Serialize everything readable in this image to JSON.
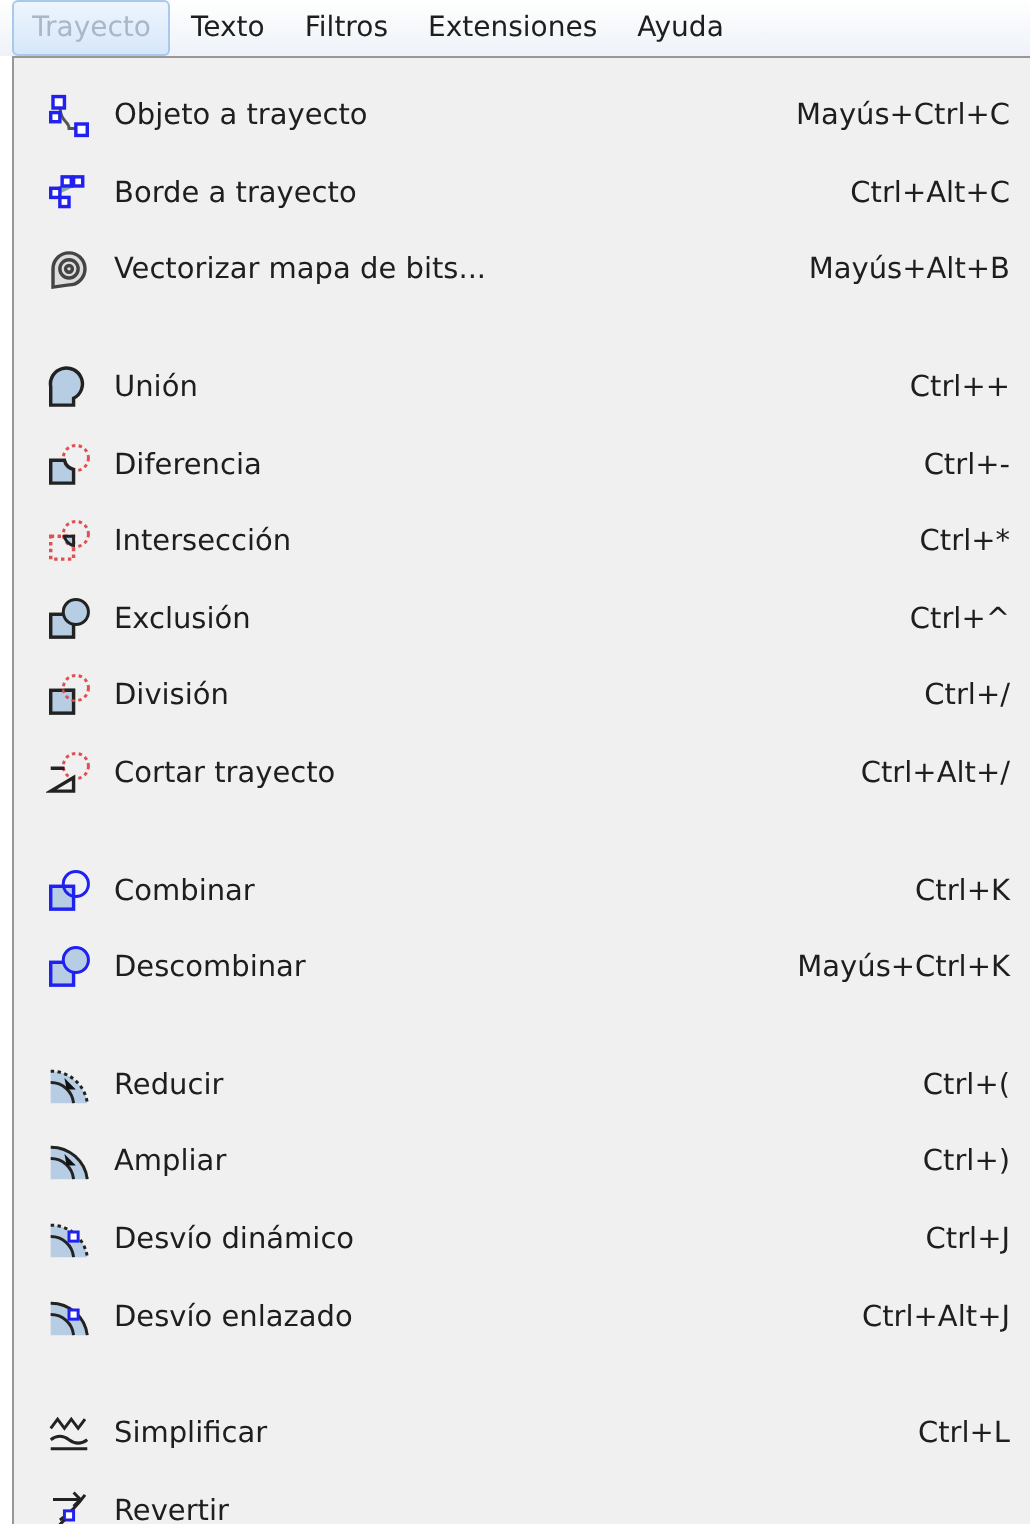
{
  "menubar": [
    {
      "label": "Trayecto",
      "selected": true
    },
    {
      "label": "Texto",
      "selected": false
    },
    {
      "label": "Filtros",
      "selected": false
    },
    {
      "label": "Extensiones",
      "selected": false
    },
    {
      "label": "Ayuda",
      "selected": false
    }
  ],
  "menu": {
    "groups": [
      [
        {
          "kind": "object-to-path",
          "label": "Objeto a trayecto",
          "shortcut": "Mayús+Ctrl+C"
        },
        {
          "kind": "stroke-to-path",
          "label": "Borde a trayecto",
          "shortcut": "Ctrl+Alt+C"
        },
        {
          "kind": "trace",
          "label": "Vectorizar mapa de bits...",
          "shortcut": "Mayús+Alt+B"
        }
      ],
      [
        {
          "kind": "union",
          "label": "Unión",
          "shortcut": "Ctrl++"
        },
        {
          "kind": "difference",
          "label": "Diferencia",
          "shortcut": "Ctrl+-"
        },
        {
          "kind": "intersection",
          "label": "Intersección",
          "shortcut": "Ctrl+*"
        },
        {
          "kind": "exclusion",
          "label": "Exclusión",
          "shortcut": "Ctrl+^"
        },
        {
          "kind": "division",
          "label": "División",
          "shortcut": "Ctrl+/"
        },
        {
          "kind": "cut",
          "label": "Cortar trayecto",
          "shortcut": "Ctrl+Alt+/"
        }
      ],
      [
        {
          "kind": "combine",
          "label": "Combinar",
          "shortcut": "Ctrl+K"
        },
        {
          "kind": "break",
          "label": "Descombinar",
          "shortcut": "Mayús+Ctrl+K"
        }
      ],
      [
        {
          "kind": "inset",
          "label": "Reducir",
          "shortcut": "Ctrl+("
        },
        {
          "kind": "outset",
          "label": "Ampliar",
          "shortcut": "Ctrl+)"
        },
        {
          "kind": "dynamic-offset",
          "label": "Desvío dinámico",
          "shortcut": "Ctrl+J"
        },
        {
          "kind": "linked-offset",
          "label": "Desvío enlazado",
          "shortcut": "Ctrl+Alt+J"
        }
      ],
      [
        {
          "kind": "simplify",
          "label": "Simplificar",
          "shortcut": "Ctrl+L"
        },
        {
          "kind": "reverse",
          "label": "Revertir"
        }
      ]
    ]
  }
}
